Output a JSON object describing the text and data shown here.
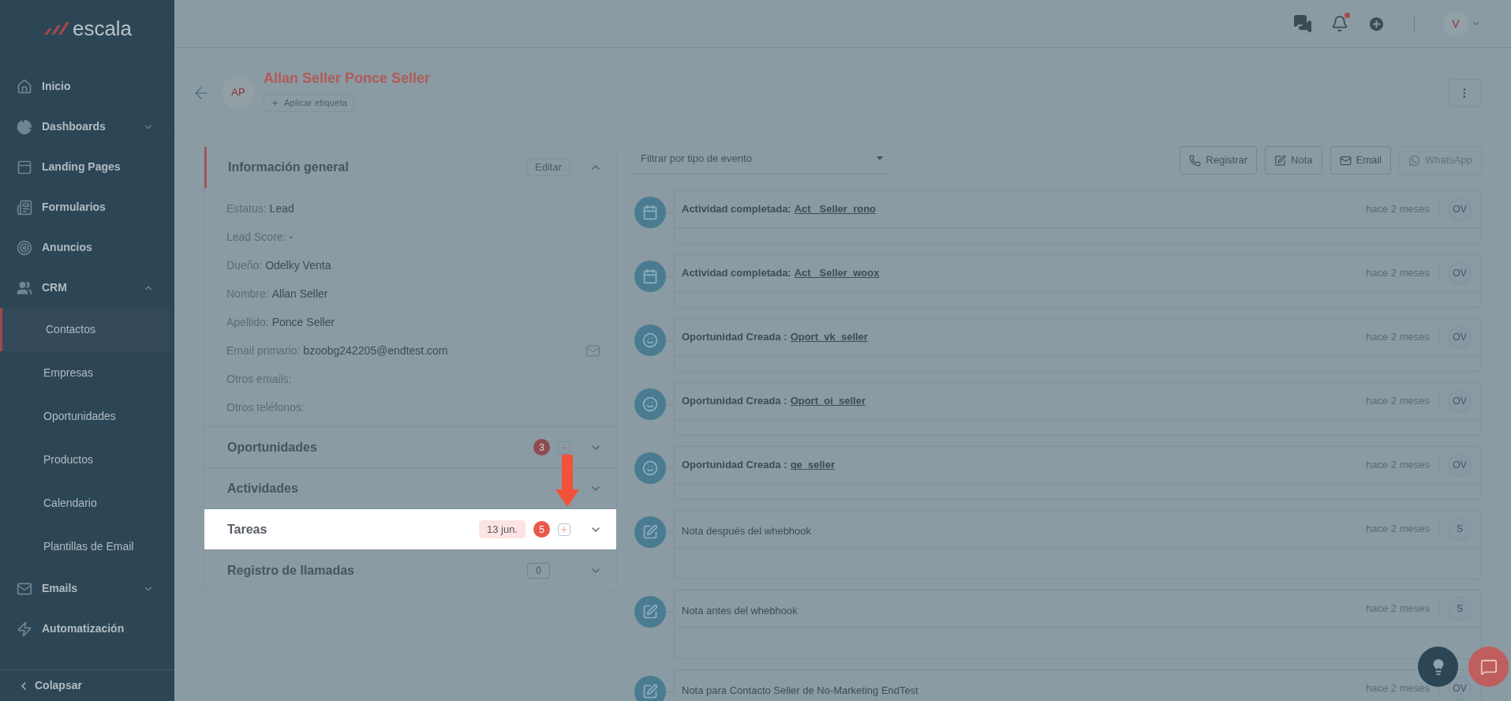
{
  "sidebar": {
    "logo": "escala",
    "items": [
      {
        "kind": "main",
        "label": "Inicio",
        "selected": false
      },
      {
        "kind": "group",
        "label": "Dashboards",
        "selected": false,
        "expanded": false
      },
      {
        "kind": "main",
        "label": "Landing Pages",
        "selected": false
      },
      {
        "kind": "main",
        "label": "Formularios",
        "selected": false
      },
      {
        "kind": "main",
        "label": "Anuncios",
        "selected": false
      },
      {
        "kind": "group",
        "label": "CRM",
        "selected": false,
        "expanded": true
      },
      {
        "kind": "sub",
        "label": "Contactos",
        "selected": true
      },
      {
        "kind": "sub",
        "label": "Empresas",
        "selected": false
      },
      {
        "kind": "sub",
        "label": "Oportunidades",
        "selected": false
      },
      {
        "kind": "sub",
        "label": "Productos",
        "selected": false
      },
      {
        "kind": "sub",
        "label": "Calendario",
        "selected": false
      },
      {
        "kind": "sub",
        "label": "Plantillas de Email",
        "selected": false
      },
      {
        "kind": "group",
        "label": "Emails",
        "selected": false,
        "expanded": false
      },
      {
        "kind": "main",
        "label": "Automatización",
        "selected": false
      }
    ],
    "collapse": "Colapsar"
  },
  "topbar": {
    "notification_dot": true,
    "avatar": "V"
  },
  "contact": {
    "initials": "AP",
    "name": "Allan Seller Ponce Seller",
    "tag_button": "Aplicar etiqueta"
  },
  "info": {
    "title": "Información general",
    "edit": "Editar",
    "expanded": true,
    "fields": [
      {
        "kind": "text",
        "label": "Estatus:",
        "value": "Lead"
      },
      {
        "kind": "text",
        "label": "Lead Score:",
        "value": "-"
      },
      {
        "kind": "text",
        "label": "Dueño:",
        "value": "Odelky Venta"
      },
      {
        "kind": "text",
        "label": "Nombre:",
        "value": "Allan Seller"
      },
      {
        "kind": "text",
        "label": "Apellido:",
        "value": "Ponce Seller"
      },
      {
        "kind": "email",
        "label": "Email primario:",
        "value": "bzoobg242205@endtest.com"
      },
      {
        "kind": "text",
        "label": "Otros emails:"
      },
      {
        "kind": "text",
        "label": "Otros teléfonos:"
      }
    ]
  },
  "sections": [
    {
      "kind": "badge-count",
      "title": "Oportunidades",
      "count": "3",
      "add": true,
      "highlighted": false
    },
    {
      "title": "Actividades",
      "add": false,
      "highlighted": false
    },
    {
      "kind": "badge-count",
      "title": "Tareas",
      "date": "13 jun.",
      "count": "5",
      "add": true,
      "highlighted": true
    },
    {
      "kind": "boxed-count",
      "title": "Registro de llamadas",
      "count": "0",
      "add": false,
      "highlighted": false
    }
  ],
  "timeline": {
    "filter": {
      "placeholder": "Filtrar por tipo de evento"
    },
    "actions": [
      {
        "label": "Registrar",
        "disabled": false
      },
      {
        "label": "Nota",
        "disabled": false
      },
      {
        "label": "Email",
        "disabled": false
      },
      {
        "label": "WhatsApp",
        "disabled": true
      }
    ],
    "events": [
      {
        "kind": "activity",
        "text": "Actividad completada:",
        "link": "Act_ Seller_rono",
        "time": "hace 2 meses",
        "user": "OV"
      },
      {
        "kind": "activity",
        "text": "Actividad completada:",
        "link": "Act_ Seller_woox",
        "time": "hace 2 meses",
        "user": "OV"
      },
      {
        "kind": "opportunity",
        "text": "Oportunidad Creada :",
        "link": "Oport_vk_seller",
        "time": "hace 2 meses",
        "user": "OV"
      },
      {
        "kind": "opportunity",
        "text": "Oportunidad Creada :",
        "link": "Oport_oi_seller",
        "time": "hace 2 meses",
        "user": "OV"
      },
      {
        "kind": "opportunity",
        "text": "Oportunidad Creada :",
        "link": "qe_seller",
        "time": "hace 2 meses",
        "user": "OV"
      },
      {
        "kind": "note",
        "text": "Nota después del whebhook",
        "time": "hace 2 meses",
        "user": "S"
      },
      {
        "kind": "note",
        "text": "Nota antes del whebhook",
        "time": "hace 2 meses",
        "user": "S"
      },
      {
        "kind": "note",
        "text": "Nota para Contacto Seller de No-Marketing EndTest",
        "time": "hace 2 meses",
        "user": "OV"
      }
    ]
  }
}
